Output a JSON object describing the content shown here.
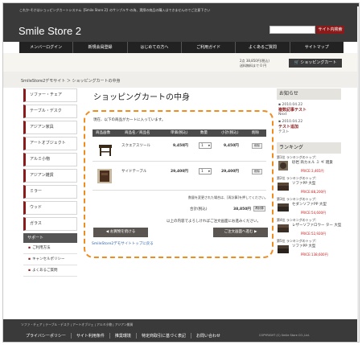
{
  "header": {
    "note": "これか-そけはショッピングカートシステム【Smile Store 2】のサンプルサ-の為、実際の商品の購入はできませんのでご注意下さい",
    "logo": "Smile Store 2",
    "search_placeholder": "",
    "search_button": "サイト内検索"
  },
  "gnav": [
    "メンバーログイン",
    "新規会員登録",
    "はじめての方へ",
    "ご利用ガイド",
    "よくあるご質問",
    "サイトマップ"
  ],
  "cart_summary": {
    "line1": "2点 38,850円(税込)",
    "line2": "送料無料まで 0 円",
    "button": "ショッピングカート"
  },
  "breadcrumb": "SmileStore2デモサイト ＞ ショッピングカートの中身",
  "left_nav": [
    "ソファー・チェア",
    "テーブル・デスク",
    "アジアン家具",
    "アートオブジェクト",
    "アルミ小物",
    "アジアン雑貨",
    "ミラー",
    "ウッド",
    "ガラス"
  ],
  "support": {
    "heading": "サポート",
    "items": [
      "ご利用方法",
      "キャンセルポリシー",
      "よくあるご質問"
    ]
  },
  "main": {
    "title": "ショッピングカートの中身",
    "intro": "現在、以下の商品がカートに入っています。",
    "columns": [
      "商品画像",
      "商品名／商品名",
      "単価(税込)",
      "数量",
      "小計(税込)",
      "削除"
    ],
    "rows": [
      {
        "name": "スクエアスツール",
        "price": "9,450円",
        "qty": "1",
        "subtotal": "9,450円",
        "del": "削除"
      },
      {
        "name": "サイドテーブル",
        "price": "29,400円",
        "qty": "1",
        "subtotal": "29,400円",
        "del": "削除"
      }
    ],
    "note": "数量を変更された場合は、[再計算]を押してください。",
    "total_label": "合計(税込)",
    "total_value": "38,850円",
    "recalc": "再計算",
    "confirm": "以上の内容でよろしければご注文画面にお進みください。",
    "continue_button": "お買物を続ける",
    "proceed_button": "ご注文画面へ進む",
    "top_link": "SmileStore2デモサイトトップに戻る"
  },
  "right": {
    "news_heading": "お知らせ",
    "news": [
      {
        "date": "2010.04.22",
        "title": "複数記事テスト",
        "sub": "Next"
      },
      {
        "date": "2010.04.22",
        "title": "テスト追加",
        "sub": "テスト"
      }
    ],
    "ranking_heading": "ランキング",
    "ranking": [
      {
        "top": "第1位 ランキングのトップ：",
        "name": "砂岩 商カエル ミ ギ 雑貨",
        "price": "PRICE:3,465円"
      },
      {
        "top": "第2位 ランキングのトップ：",
        "name": "ソファPP 大型",
        "price": "PRICE:88,200円"
      },
      {
        "top": "第3位 ランキングのトップ：",
        "name": "セダンソファPP 大型",
        "price": "PRICE:54,600円"
      },
      {
        "top": "第4位 ランキングのトップ：",
        "name": "レザーソファロウー ター 大型",
        "price": "PRICE:52,920円"
      },
      {
        "top": "第5位 ランキングのトップ：",
        "name": "ソファPP 大型",
        "price": "PRICE:138,600円"
      }
    ]
  },
  "footer": {
    "links": "ソファ・チェア | テーブル・デスク | アートオブジェ | アルミ小物 | アジアン雑貨",
    "nav": [
      "プライバシーポリシー",
      "サイト利用条件",
      "推奨環境",
      "特定商取引に基づく表記",
      "お問い合わせ"
    ],
    "copyright": "COPYRIGHT (C) Smile Store CO.,Ltd."
  }
}
